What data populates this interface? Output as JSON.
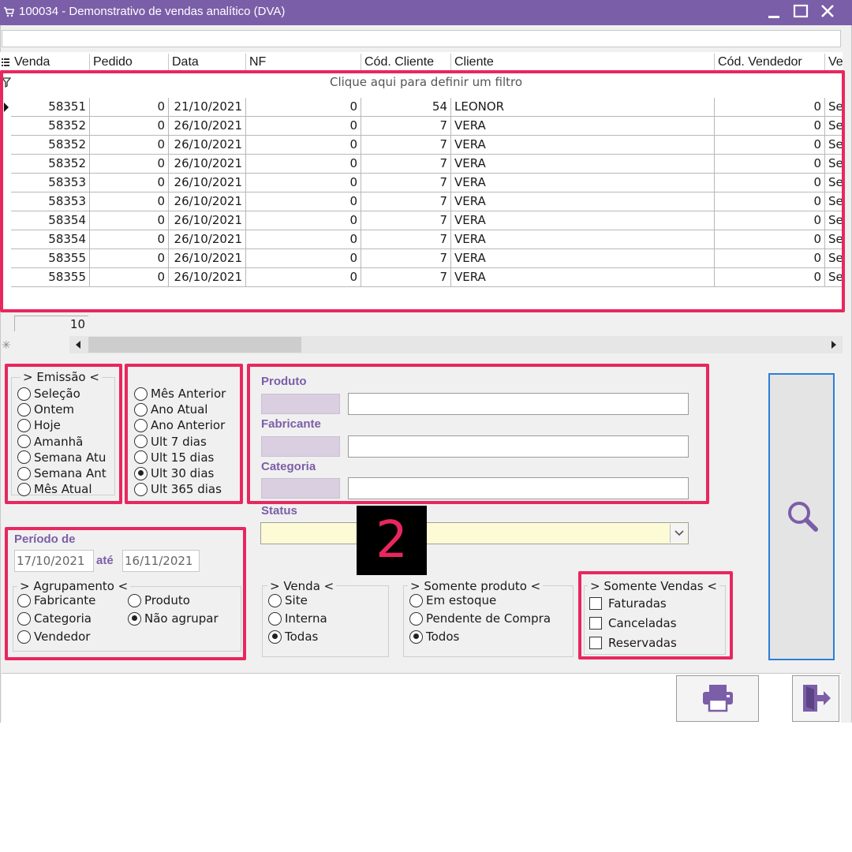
{
  "window": {
    "title": "100034 - Demonstrativo de vendas analítico (DVA)"
  },
  "grid": {
    "columns": [
      "Venda",
      "Pedido",
      "Data",
      "NF",
      "Cód. Cliente",
      "Cliente",
      "Cód. Vendedor",
      "Ve"
    ],
    "filter_hint": "Clique aqui para definir um filtro",
    "rows": [
      [
        "58351",
        "0",
        "21/10/2021",
        "0",
        "54",
        "LEONOR",
        "0",
        "Se"
      ],
      [
        "58352",
        "0",
        "26/10/2021",
        "0",
        "7",
        "VERA",
        "0",
        "Se"
      ],
      [
        "58352",
        "0",
        "26/10/2021",
        "0",
        "7",
        "VERA",
        "0",
        "Se"
      ],
      [
        "58352",
        "0",
        "26/10/2021",
        "0",
        "7",
        "VERA",
        "0",
        "Se"
      ],
      [
        "58353",
        "0",
        "26/10/2021",
        "0",
        "7",
        "VERA",
        "0",
        "Se"
      ],
      [
        "58353",
        "0",
        "26/10/2021",
        "0",
        "7",
        "VERA",
        "0",
        "Se"
      ],
      [
        "58354",
        "0",
        "26/10/2021",
        "0",
        "7",
        "VERA",
        "0",
        "Se"
      ],
      [
        "58354",
        "0",
        "26/10/2021",
        "0",
        "7",
        "VERA",
        "0",
        "Se"
      ],
      [
        "58355",
        "0",
        "26/10/2021",
        "0",
        "7",
        "VERA",
        "0",
        "Se"
      ],
      [
        "58355",
        "0",
        "26/10/2021",
        "0",
        "7",
        "VERA",
        "0",
        "Se"
      ]
    ],
    "row_count": "10"
  },
  "emissao": {
    "label": "> Emissão <",
    "col1": [
      "Seleção",
      "Ontem",
      "Hoje",
      "Amanhã",
      "Semana Atu",
      "Semana Ant",
      "Mês Atual"
    ],
    "col2": [
      "Mês Anterior",
      "Ano Atual",
      "Ano Anterior",
      "Ult 7 dias",
      "Ult 15 dias",
      "Ult 30 dias",
      "Ult 365 dias"
    ],
    "selected": "Ult 30 dias"
  },
  "filters": {
    "produto_label": "Produto",
    "fabricante_label": "Fabricante",
    "categoria_label": "Categoria",
    "status_label": "Status",
    "produto_value": "",
    "fabricante_value": "",
    "categoria_value": "",
    "status_value": ""
  },
  "periodo": {
    "label": "Período de",
    "from": "17/10/2021",
    "ate": "até",
    "to": "16/11/2021"
  },
  "agrupamento": {
    "label": "> Agrupamento <",
    "options": [
      "Fabricante",
      "Produto",
      "Categoria",
      "Não agrupar",
      "Vendedor"
    ],
    "selected": "Não agrupar"
  },
  "venda": {
    "label": "> Venda <",
    "options": [
      "Site",
      "Interna",
      "Todas"
    ],
    "selected": "Todas"
  },
  "somente_produto": {
    "label": "> Somente produto <",
    "options": [
      "Em estoque",
      "Pendente de Compra",
      "Todos"
    ],
    "selected": "Todos"
  },
  "somente_vendas": {
    "label": "> Somente Vendas <",
    "options": [
      "Faturadas",
      "Canceladas",
      "Reservadas"
    ]
  },
  "annotation": {
    "step": "2"
  },
  "icons": {
    "search": "search-icon",
    "print": "printer-icon",
    "exit": "exit-icon"
  },
  "colors": {
    "accent": "#7b5ea8",
    "highlight": "#e8275e",
    "status_bg": "#fdfbd6",
    "code_bg": "#d9cfe0"
  }
}
